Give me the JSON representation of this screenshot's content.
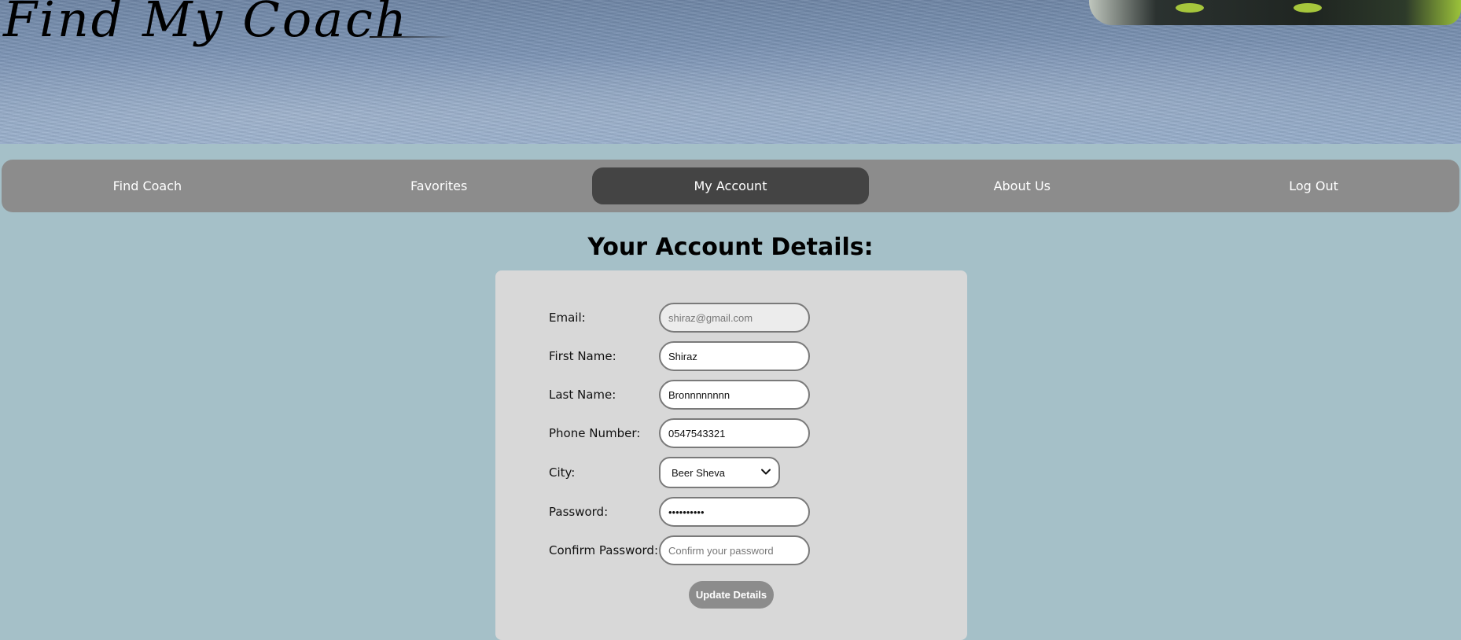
{
  "header": {
    "site_title": "Find My Coach"
  },
  "nav": {
    "items": [
      {
        "label": "Find Coach",
        "active": false
      },
      {
        "label": "Favorites",
        "active": false
      },
      {
        "label": "My Account",
        "active": true
      },
      {
        "label": "About Us",
        "active": false
      },
      {
        "label": "Log Out",
        "active": false
      }
    ]
  },
  "main": {
    "title": "Your Account Details:",
    "form": {
      "email": {
        "label": "Email:",
        "placeholder": "shiraz@gmail.com",
        "disabled": true
      },
      "first_name": {
        "label": "First Name:",
        "value": "Shiraz"
      },
      "last_name": {
        "label": "Last Name:",
        "value": "Bronnnnnnnn"
      },
      "phone": {
        "label": "Phone Number:",
        "value": "0547543321"
      },
      "city": {
        "label": "City:",
        "value": "Beer Sheva"
      },
      "password": {
        "label": "Password:",
        "value": "••••••••••"
      },
      "confirm_password": {
        "label": "Confirm Password:",
        "placeholder": "Confirm your password"
      },
      "submit_label": "Update Details"
    }
  },
  "colors": {
    "page_background": "#a5c0c8",
    "nav_background": "#8c8c8c",
    "nav_active": "#444444",
    "card_background": "#d8d8d8",
    "button_background": "#8c8c8c"
  },
  "icons": {
    "city_select": "chevron-down-icon"
  }
}
